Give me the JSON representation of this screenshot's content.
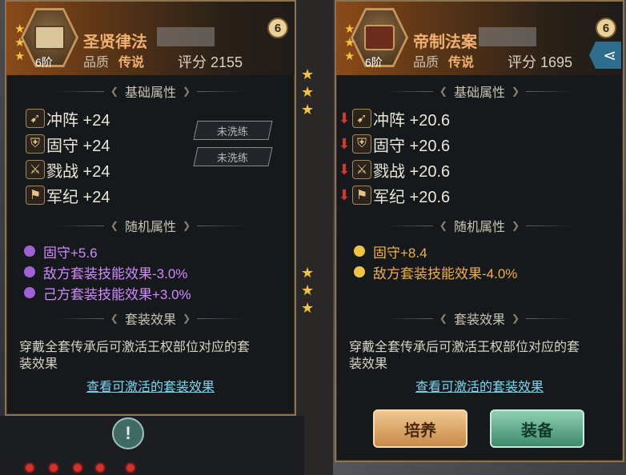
{
  "left_card": {
    "name": "圣贤律法",
    "tier": "6阶",
    "level": "6",
    "quality_label": "品质",
    "quality_value": "传说",
    "score": "评分 2155",
    "base_section": "基础属性",
    "base_attrs": [
      {
        "label": "冲阵 +24",
        "icon": "charge-icon"
      },
      {
        "label": "固守 +24",
        "icon": "shield-icon"
      },
      {
        "label": "戮战 +24",
        "icon": "axes-icon"
      },
      {
        "label": "军纪 +24",
        "icon": "banner-icon"
      }
    ],
    "unwashed_1": "未洗练",
    "unwashed_2": "未洗练",
    "random_section": "随机属性",
    "random_attrs": [
      "固守+5.6",
      "敌方套装技能效果-3.0%",
      "己方套装技能效果+3.0%"
    ],
    "set_section": "套装效果",
    "set_desc_1": "穿戴全套传承后可激活王权部位对应的套",
    "set_desc_2": "装效果",
    "set_link": "查看可激活的套装效果"
  },
  "right_card": {
    "name": "帝制法案",
    "tier": "6阶",
    "level": "6",
    "quality_label": "品质",
    "quality_value": "传说",
    "score": "评分 1695",
    "base_section": "基础属性",
    "base_attrs": [
      {
        "label": "冲阵 +20.6",
        "icon": "charge-icon"
      },
      {
        "label": "固守 +20.6",
        "icon": "shield-icon"
      },
      {
        "label": "戮战 +20.6",
        "icon": "axes-icon"
      },
      {
        "label": "军纪 +20.6",
        "icon": "banner-icon"
      }
    ],
    "random_section": "随机属性",
    "random_attrs": [
      "固守+8.4",
      "敌方套装技能效果-4.0%"
    ],
    "set_section": "套装效果",
    "set_desc_1": "穿戴全套传承后可激活王权部位对应的套",
    "set_desc_2": "装效果",
    "set_link": "查看可激活的套装效果",
    "train_button": "培养",
    "equip_button": "装备"
  },
  "colors": {
    "purple_attr": "#d08aff",
    "gold_attr": "#f2b040",
    "decrease_arrow": "#d9342b",
    "name": "#f0b070"
  }
}
